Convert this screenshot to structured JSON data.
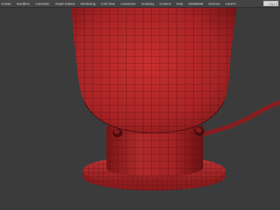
{
  "menubar": {
    "items": [
      "Create",
      "Modifiers",
      "Animation",
      "Graph Editors",
      "Rendering",
      "Civil View",
      "Customize",
      "Scripting",
      "Content",
      "Help",
      "DDM8288",
      "Decima",
      "AutoFX"
    ]
  },
  "search": {
    "placeholder": "Sign in"
  },
  "viewport": {
    "mesh_color": "#b8282b",
    "wire_color": "#3a0808",
    "background_color": "#3b3b3b"
  }
}
